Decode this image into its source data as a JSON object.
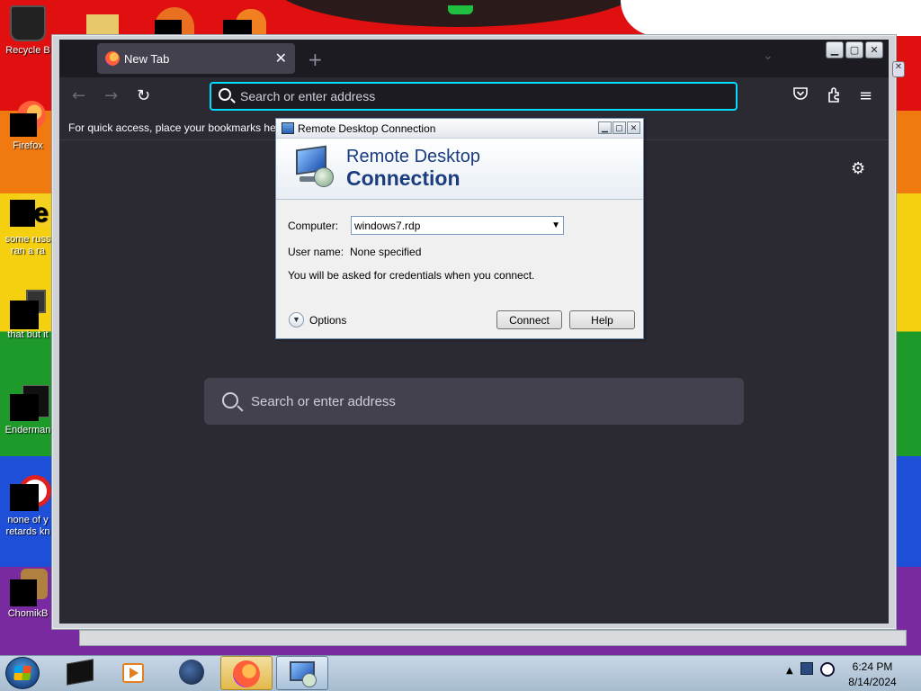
{
  "desktop": {
    "icons": [
      {
        "label": "Recycle B",
        "icon": "recycle-bin-icon"
      },
      {
        "label": "Firefox",
        "icon": "firefox-icon"
      },
      {
        "label": "some russ\nran a ra",
        "icon": "document-icon"
      },
      {
        "label": "that but it",
        "icon": "window-icon"
      },
      {
        "label": "Enderman",
        "icon": "terminal-icon"
      },
      {
        "label": "none of y\nretards kn",
        "icon": "opera-icon"
      },
      {
        "label": "ChomikB",
        "icon": "hamster-icon"
      }
    ]
  },
  "browser": {
    "tab_title": "New Tab",
    "tab_close": "✕",
    "new_tab": "+",
    "url_placeholder": "Search or enter address",
    "bookmarks_hint": "For quick access, place your bookmarks her",
    "content_search_placeholder": "Search or enter address"
  },
  "rdp": {
    "title": "Remote Desktop Connection",
    "heading_line1": "Remote Desktop",
    "heading_line2": "Connection",
    "computer_label": "Computer:",
    "computer_value": "windows7.rdp",
    "username_label": "User name:",
    "username_value": "None specified",
    "credentials_note": "You will be asked for credentials when you connect.",
    "options_label": "Options",
    "connect_label": "Connect",
    "help_label": "Help"
  },
  "taskbar": {
    "time": "6:24 PM",
    "date": "8/14/2024"
  },
  "colors": {
    "firefox_dark": "#2b2a33",
    "url_focus": "#00ddff",
    "rdp_heading": "#1a3c80"
  }
}
